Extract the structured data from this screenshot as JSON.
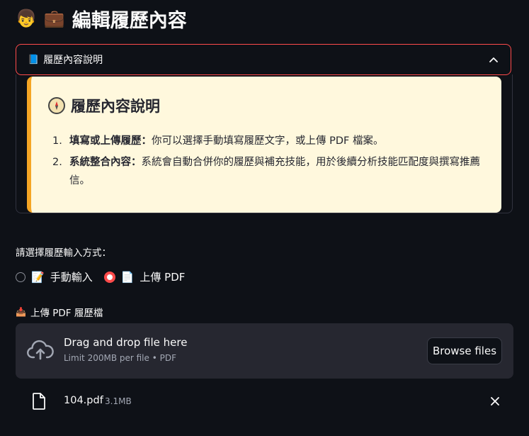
{
  "page": {
    "title_emoji_1": "👦",
    "title_emoji_2": "💼",
    "title": "編輯履歷內容"
  },
  "expander": {
    "icon": "📘",
    "label": "履歷內容說明",
    "chevron_icon": "chevron-up-icon"
  },
  "info": {
    "title": "履歷內容說明",
    "icon": "compass-icon",
    "items": [
      {
        "num": "1.",
        "bold": "填寫或上傳履歷：",
        "text": "你可以選擇手動填寫履歷文字，或上傳 PDF 檔案。"
      },
      {
        "num": "2.",
        "bold": "系統整合內容：",
        "text": "系統會自動合併你的履歷與補充技能，用於後續分析技能匹配度與撰寫推薦信。"
      }
    ],
    "accent_color": "#f5a524",
    "background_color": "#fff8dd"
  },
  "radio": {
    "label": "請選擇履歷輸入方式：",
    "options": [
      {
        "icon": "📝",
        "label": "手動輸入",
        "selected": false
      },
      {
        "icon": "📄",
        "label": "上傳 PDF",
        "selected": true
      }
    ]
  },
  "upload": {
    "icon": "📥",
    "label": "上傳 PDF 履歷檔",
    "drop_text": "Drag and drop file here",
    "limit_text": "Limit 200MB per file • PDF",
    "browse_label": "Browse files"
  },
  "file": {
    "name": "104.pdf",
    "size": "3.1MB"
  },
  "colors": {
    "accent": "#ff4b4b",
    "background": "#0e1117",
    "surface": "#262730"
  }
}
